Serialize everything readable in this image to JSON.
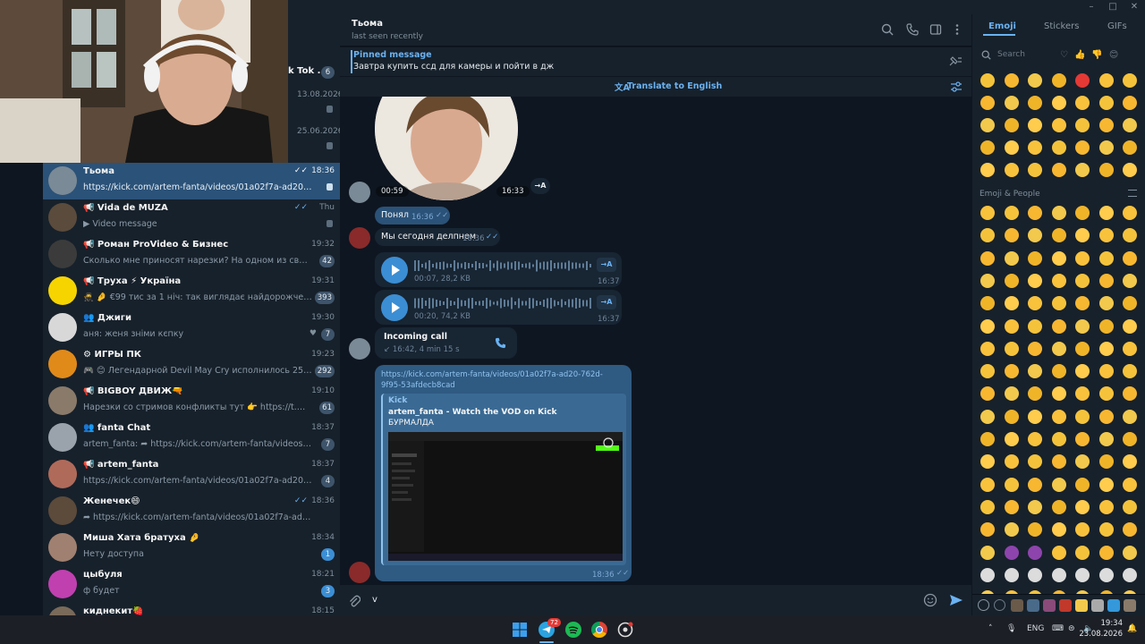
{
  "window": {
    "controls": [
      "–",
      "□",
      "✕"
    ]
  },
  "sidebar": {
    "peek_chats": [
      {
        "name_fragment": "k Tok ...",
        "badge": "6"
      },
      {
        "time": "13.08.2026"
      },
      {
        "time": "25.06.2026"
      }
    ],
    "chats": [
      {
        "name": "Тьома",
        "time": "18:36",
        "preview": "https://kick.com/artem-fanta/videos/01a02f7a-ad20-762d-9f9...",
        "pinned": true,
        "read": true,
        "active": true,
        "avatar_color": "#7a8a96"
      },
      {
        "name": "📢 Vida de MUZA",
        "time": "Thu",
        "preview": "▶ Video message",
        "pinned": true,
        "read": true,
        "avatar_color": "#5a4b3c"
      },
      {
        "name": "📢 Роман ProVideo & Бизнес",
        "time": "19:32",
        "preview": "Сколько мне приносят нарезки?  На одном из своих кана...",
        "badge": "42",
        "avatar_color": "#3b3b3b"
      },
      {
        "name": "📢 Труха ⚡ Україна",
        "time": "19:31",
        "preview": "🥷 🤌 €99 тис за 1 ніч: так виглядає найдорожче у світі ...",
        "badge": "393",
        "avatar_color": "#f5d400"
      },
      {
        "name": "👥 Джиги",
        "time": "19:30",
        "preview": "аня: женя зніми кєпку",
        "badge": "7",
        "heart": true,
        "avatar_color": "#d8d8d8"
      },
      {
        "name": "⚙ ИГРЫ ПК",
        "time": "19:23",
        "preview": "🎮 😊 Легендарной Devil May Cry исполнилось 25 лет  Перв...",
        "badge": "292",
        "avatar_color": "#e08a1a"
      },
      {
        "name": "📢 BIGBOY ДВИЖ🔫",
        "time": "19:10",
        "preview": "Нарезки со стримов конфликты тут 👉 https://t.me/BIGBOY_L...",
        "badge": "61",
        "avatar_color": "#8a7a6a"
      },
      {
        "name": "👥 fanta Chat",
        "time": "18:37",
        "preview": "artem_fanta: ➦ https://kick.com/artem-fanta/videos/01a02f7...",
        "badge": "7",
        "avatar_color": "#9aa3ab"
      },
      {
        "name": "📢 artem_fanta",
        "time": "18:37",
        "preview": "https://kick.com/artem-fanta/videos/01a02f7a-ad20-762d-9f9...",
        "badge": "4",
        "avatar_color": "#b06a5a"
      },
      {
        "name": "Женечек😄",
        "time": "18:36",
        "preview": "➦ https://kick.com/artem-fanta/videos/01a02f7a-ad20-762d-9f9-...",
        "read": true,
        "avatar_color": "#5c4a3a"
      },
      {
        "name": "Миша Хата братуха 🤌",
        "time": "18:34",
        "preview": "Нету доступа",
        "badge": "1",
        "badge_blue": true,
        "avatar_color": "#a08070"
      },
      {
        "name": "цыбуля",
        "time": "18:21",
        "preview": "ф будет",
        "badge": "3",
        "badge_blue": true,
        "avatar_color": "#c040b0"
      },
      {
        "name": "киднекит🍓",
        "time": "18:15",
        "preview": "",
        "avatar_color": "#7a6a5a"
      }
    ]
  },
  "header": {
    "name": "Тьома",
    "status": "last seen recently",
    "icons": [
      "search-icon",
      "phone-icon",
      "sidebar-toggle-icon",
      "more-vertical-icon"
    ]
  },
  "pinned": {
    "title": "Pinned message",
    "text": "Завтра купить ссд для камеры и пойти в дж"
  },
  "translate": {
    "label": "Translate to English"
  },
  "messages": {
    "video_note": {
      "duration": "00:59",
      "time": "16:33",
      "transcribe": "→A"
    },
    "msg1": {
      "text": "Понял",
      "time": "16:36"
    },
    "msg2": {
      "text": "Мы сегодня делпнем",
      "time": "16:36"
    },
    "voice1": {
      "meta": "00:07, 28,2 KB",
      "time": "16:37",
      "transcribe": "→A"
    },
    "voice2": {
      "meta": "00:20, 74,2 KB",
      "time": "16:37",
      "transcribe": "→A"
    },
    "call": {
      "title": "Incoming call",
      "meta": "↙ 16:42, 4 min 15 s"
    },
    "link": {
      "url": "https://kick.com/artem-fanta/videos/01a02f7a-ad20-762d-9f95-53afdecb8cad",
      "site": "Kick",
      "title": "artem_fanta - Watch the VOD on Kick",
      "desc": "БУРМАЛДА",
      "time": "18:36"
    }
  },
  "composer": {
    "value": "v"
  },
  "emoji_panel": {
    "tabs": [
      "Emoji",
      "Stickers",
      "GIFs"
    ],
    "active_tab": "Emoji",
    "search_placeholder": "Search",
    "section_label": "Emoji & People"
  },
  "taskbar": {
    "lang": "ENG",
    "time": "19:34",
    "date": "23.08.2026",
    "telegram_badge": "72"
  },
  "colors": {
    "accent": "#6ab2f2",
    "active_chat": "#2b5278",
    "outgoing": "#2b5278",
    "incoming": "#182533"
  }
}
